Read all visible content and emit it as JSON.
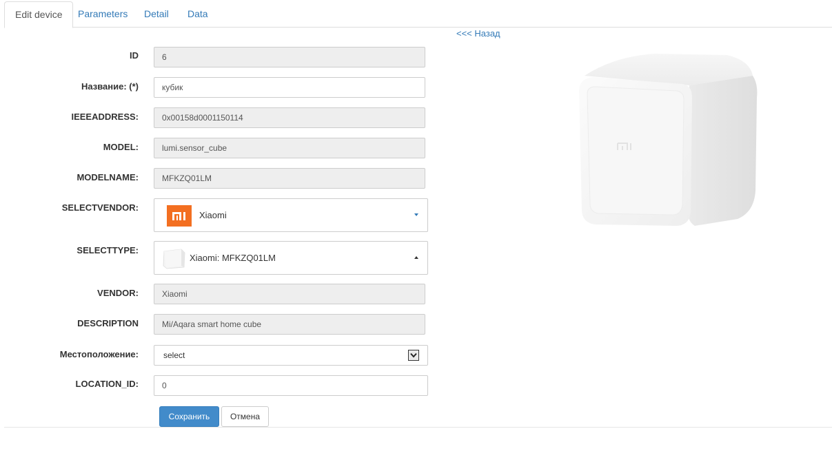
{
  "tabs": [
    {
      "label": "Edit device",
      "active": true
    },
    {
      "label": "Parameters",
      "active": false
    },
    {
      "label": "Detail",
      "active": false
    },
    {
      "label": "Data",
      "active": false
    }
  ],
  "back_link": "<<< Назад",
  "form": {
    "id": {
      "label": "ID",
      "value": "6"
    },
    "name": {
      "label": "Название: (*)",
      "value": "кубик"
    },
    "ieeeaddress": {
      "label": "IEEEADDRESS:",
      "value": "0x00158d0001150114"
    },
    "model": {
      "label": "MODEL:",
      "value": "lumi.sensor_cube"
    },
    "modelname": {
      "label": "MODELNAME:",
      "value": "MFKZQ01LM"
    },
    "selectvendor": {
      "label": "SELECTVENDOR:",
      "value": "Xiaomi",
      "icon": "mi-logo-icon"
    },
    "selecttype": {
      "label": "SELECTTYPE:",
      "value": "Xiaomi: MFKZQ01LM",
      "icon": "cube-thumbnail-icon"
    },
    "vendor": {
      "label": "VENDOR:",
      "value": "Xiaomi"
    },
    "description": {
      "label": "DESCRIPTION",
      "value": "Mi/Aqara smart home cube"
    },
    "location": {
      "label": "Местоположение:",
      "value": "select"
    },
    "location_id": {
      "label": "LOCATION_ID:",
      "value": "0"
    }
  },
  "buttons": {
    "save": "Сохранить",
    "cancel": "Отмена"
  },
  "colors": {
    "link": "#337ab7",
    "primary_button": "#428bca",
    "readonly_bg": "#eeeeee",
    "mi_orange": "#f36f21"
  }
}
